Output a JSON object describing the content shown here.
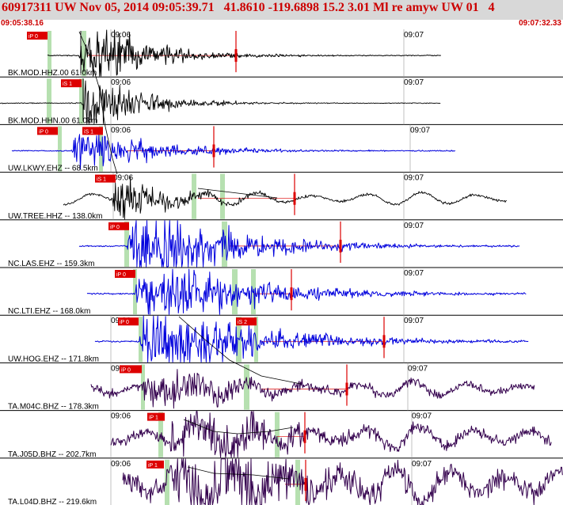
{
  "header": {
    "title": "60917311 UW Nov 05, 2014 09:05:39.71   41.8610 -119.6898 15.2 3.01 Ml re amyw UW 01   4",
    "start_time": "09:05:38.16",
    "end_time": "09:07:32.33"
  },
  "colors": {
    "header_bg": "#d8d8d8",
    "header_text": "#cc0000",
    "trace_black": "#000000",
    "trace_blue": "#0000dd",
    "trace_purple": "#33004d",
    "pick_marker": "#dd0000",
    "window_marker": "#b6e0b0",
    "arrival_curve": "#000000",
    "divider": "#000000",
    "tick": "#999999"
  },
  "stations": [
    {
      "label": "BK.MOD.HHZ.00 61.0km",
      "color": "black",
      "tick_labels": [
        "09:06",
        "09:07"
      ],
      "picks": [
        "iP 0"
      ]
    },
    {
      "label": "BK.MOD.HHN.00 61.0km",
      "color": "black",
      "tick_labels": [
        "09:06",
        "09:07"
      ],
      "picks": [
        "iS 1"
      ]
    },
    {
      "label": "UW.LKWY.EHZ -- 68.5km",
      "color": "blue",
      "tick_labels": [
        "09:06",
        "09:07"
      ],
      "picks": [
        "iP 0",
        "iS 1"
      ]
    },
    {
      "label": "UW.TREE.HHZ -- 138.0km",
      "color": "black",
      "tick_labels": [
        "09:06",
        "09:07"
      ],
      "picks": [
        "iS 1"
      ]
    },
    {
      "label": "NC.LAS.EHZ -- 159.3km",
      "color": "blue",
      "tick_labels": [
        "09:07"
      ],
      "picks": [
        "iP 0"
      ]
    },
    {
      "label": "NC.LTI.EHZ -- 168.0km",
      "color": "blue",
      "tick_labels": [
        "09:07"
      ],
      "picks": [
        "iP 0"
      ]
    },
    {
      "label": "UW.HOG.EHZ -- 171.8km",
      "color": "blue",
      "tick_labels": [
        "09:06",
        "09:07"
      ],
      "picks": [
        "iP 0",
        "iS 2"
      ]
    },
    {
      "label": "TA.M04C.BHZ -- 178.3km",
      "color": "purple",
      "tick_labels": [
        "09:06",
        "09:07"
      ],
      "picks": [
        "iP 0"
      ]
    },
    {
      "label": "TA.J05D.BHZ -- 202.7km",
      "color": "purple",
      "tick_labels": [
        "09:06",
        "09:07"
      ],
      "picks": [
        "iP 1"
      ]
    },
    {
      "label": "TA.L04D.BHZ -- 219.6km",
      "color": "purple",
      "tick_labels": [
        "09:06",
        "09:07"
      ],
      "picks": [
        "iP 1"
      ]
    }
  ]
}
